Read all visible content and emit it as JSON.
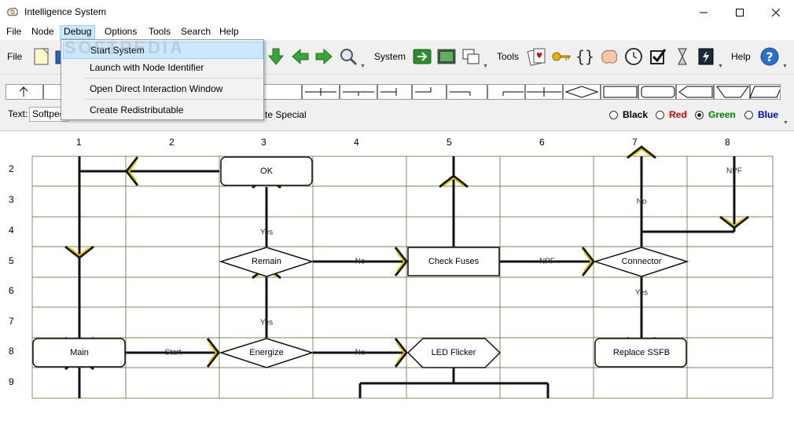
{
  "window": {
    "title": "Intelligence System"
  },
  "menu": [
    "File",
    "Node",
    "Debug",
    "Options",
    "Tools",
    "Search",
    "Help"
  ],
  "debug_menu": {
    "items": [
      "Start System",
      "Launch with Node Identifier",
      "Open Direct Interaction Window",
      "Create Redistributable"
    ]
  },
  "toolbar": {
    "file_label": "File",
    "system_label": "System",
    "tools_label": "Tools",
    "help_label": "Help"
  },
  "strip": {
    "text_label": "Text:",
    "text_value": "Softpedia",
    "special_label": "te Special",
    "colors": [
      {
        "label": "Black",
        "hex": "#000000",
        "checked": false
      },
      {
        "label": "Red",
        "hex": "#d00000",
        "checked": false
      },
      {
        "label": "Green",
        "hex": "#008000",
        "checked": true
      },
      {
        "label": "Blue",
        "hex": "#0000c8",
        "checked": false
      }
    ]
  },
  "grid": {
    "columns": [
      "1",
      "2",
      "3",
      "4",
      "5",
      "6",
      "7",
      "8"
    ],
    "rows": [
      "2",
      "3",
      "4",
      "5",
      "6",
      "7",
      "8",
      "9"
    ]
  },
  "nodes": {
    "ok": "OK",
    "remain": "Remain",
    "check_fuses": "Check Fuses",
    "connector": "Connector",
    "main": "Main",
    "energize": "Energize",
    "led_flicker": "LED Flicker",
    "replace_ssfb": "Replace SSFB"
  },
  "flow_labels": {
    "yes_remain_ok": "Yes",
    "no_remain": "No",
    "npf_fuses": "NPF",
    "no_connector": "No",
    "npf_col8": "NPF",
    "yes_connector": "Yes",
    "yes_energize": "Yes",
    "start": "Start",
    "no_energize": "No"
  },
  "watermark": "SOFTPEDIA",
  "accent": "#cce8ff"
}
